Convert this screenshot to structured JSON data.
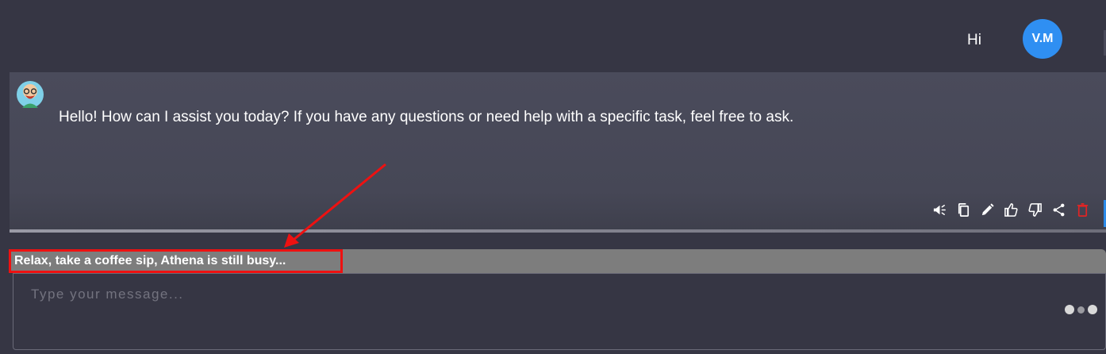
{
  "header": {
    "greeting": "Hi",
    "user_initials": "V.M",
    "avatar_color": "#2f8ff2"
  },
  "message": {
    "sender_avatar": "bot-avatar-icon",
    "text": "Hello! How can I assist you today? If you have any questions or need help with a specific task, feel free to ask.",
    "actions": [
      {
        "icon": "speaker-icon"
      },
      {
        "icon": "copy-icon"
      },
      {
        "icon": "edit-icon"
      },
      {
        "icon": "thumbs-up-icon"
      },
      {
        "icon": "thumbs-down-icon"
      },
      {
        "icon": "share-icon"
      },
      {
        "icon": "delete-icon",
        "color": "#e02424"
      }
    ]
  },
  "status": {
    "text": "Relax, take a coffee sip, Athena is still busy...",
    "highlight_color": "#ee1111"
  },
  "composer": {
    "placeholder": "Type your message..."
  },
  "colors": {
    "background": "#363644",
    "message_panel": "#464756",
    "status_bar": "#7d7d7d"
  }
}
